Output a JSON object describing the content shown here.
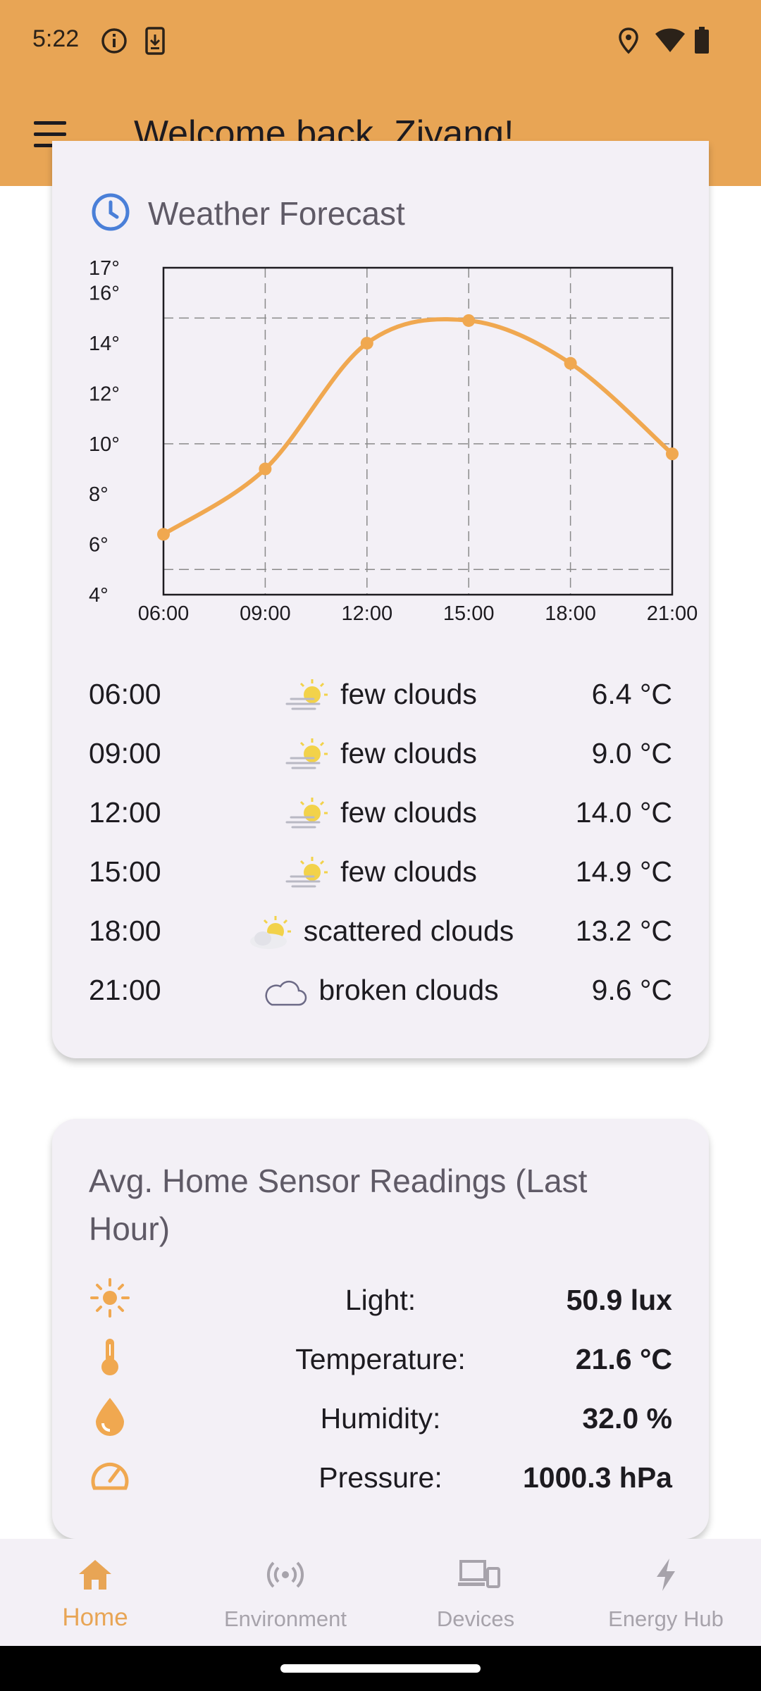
{
  "status_bar": {
    "time": "5:22",
    "icons": [
      "info-icon",
      "download-icon",
      "location-icon",
      "wifi-icon",
      "battery-icon"
    ]
  },
  "app_bar": {
    "title": "Welcome back, Ziyang!",
    "menu_icon": "menu-icon"
  },
  "weather_card": {
    "title": "Weather Forecast",
    "icon": "clock-icon",
    "forecast": [
      {
        "time": "06:00",
        "condition": "few clouds",
        "icon": "few-clouds-icon",
        "temp": "6.4 °C"
      },
      {
        "time": "09:00",
        "condition": "few clouds",
        "icon": "few-clouds-icon",
        "temp": "9.0 °C"
      },
      {
        "time": "12:00",
        "condition": "few clouds",
        "icon": "few-clouds-icon",
        "temp": "14.0 °C"
      },
      {
        "time": "15:00",
        "condition": "few clouds",
        "icon": "few-clouds-icon",
        "temp": "14.9 °C"
      },
      {
        "time": "18:00",
        "condition": "scattered clouds",
        "icon": "scattered-clouds-icon",
        "temp": "13.2 °C"
      },
      {
        "time": "21:00",
        "condition": "broken clouds",
        "icon": "broken-clouds-icon",
        "temp": "9.6 °C"
      }
    ]
  },
  "chart_data": {
    "type": "line",
    "x": [
      "06:00",
      "09:00",
      "12:00",
      "15:00",
      "18:00",
      "21:00"
    ],
    "series": [
      {
        "values": [
          6.4,
          9.0,
          14.0,
          14.9,
          13.2,
          9.6
        ],
        "color": "#f0a850"
      }
    ],
    "y_ticks": [
      "4°",
      "6°",
      "8°",
      "10°",
      "12°",
      "14°",
      "16°",
      "17°"
    ],
    "ylim": [
      4,
      17
    ],
    "grid": true,
    "smooth": true
  },
  "sensor_card": {
    "title": "Avg. Home Sensor Readings (Last Hour)",
    "readings": [
      {
        "icon": "sun-icon",
        "label": "Light:",
        "value": "50.9 lux"
      },
      {
        "icon": "thermometer-icon",
        "label": "Temperature:",
        "value": "21.6 °C"
      },
      {
        "icon": "water-drop-icon",
        "label": "Humidity:",
        "value": "32.0 %"
      },
      {
        "icon": "gauge-icon",
        "label": "Pressure:",
        "value": "1000.3 hPa"
      }
    ],
    "accent_color": "#f0a850"
  },
  "bottom_nav": {
    "items": [
      {
        "label": "Home",
        "icon": "home-icon",
        "active": true
      },
      {
        "label": "Environment",
        "icon": "sensors-icon",
        "active": false
      },
      {
        "label": "Devices",
        "icon": "devices-icon",
        "active": false
      },
      {
        "label": "Energy Hub",
        "icon": "bolt-icon",
        "active": false
      }
    ],
    "active_color": "#e8a555"
  }
}
